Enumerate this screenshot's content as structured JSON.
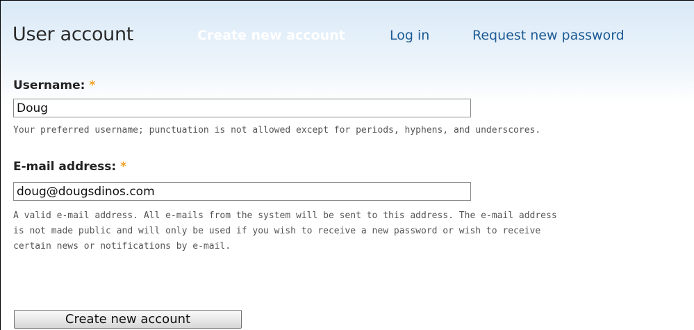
{
  "header": {
    "title": "User account",
    "tabs": [
      {
        "label": "Create new account",
        "active": true
      },
      {
        "label": "Log in",
        "active": false
      },
      {
        "label": "Request new password",
        "active": false
      }
    ]
  },
  "form": {
    "username": {
      "label": "Username:",
      "required_marker": "*",
      "value": "Doug",
      "description": "Your preferred username; punctuation is not allowed except for periods, hyphens, and underscores."
    },
    "email": {
      "label": "E-mail address:",
      "required_marker": "*",
      "value": "doug@dougsdinos.com",
      "description_lines": [
        "A valid e-mail address. All e-mails from the system will be sent to this address. The e-mail address",
        "is not made public and will only be used if you wish to receive a new password or wish to receive",
        "certain news or notifications by e-mail."
      ]
    },
    "submit_label": "Create new account"
  },
  "colors": {
    "link": "#1d5b94",
    "required": "#f0a020",
    "header_gradient_top": "#d9e9f7"
  }
}
